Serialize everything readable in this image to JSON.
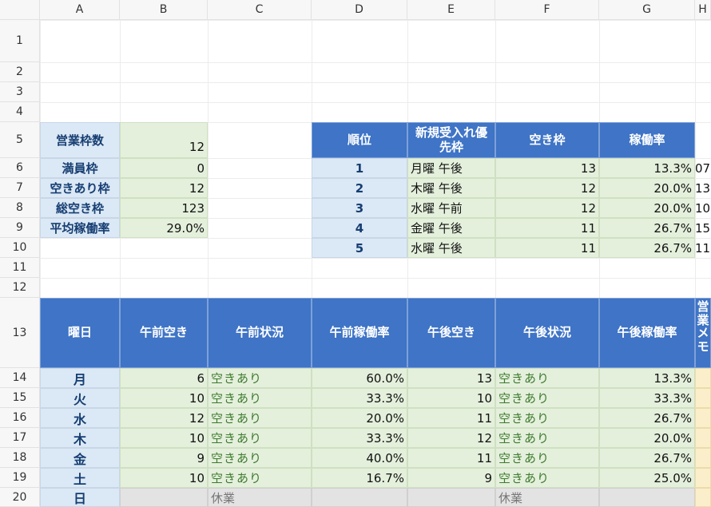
{
  "columns": [
    "A",
    "B",
    "C",
    "D",
    "E",
    "F",
    "G",
    "H"
  ],
  "rows": [
    "1",
    "2",
    "3",
    "4",
    "5",
    "6",
    "7",
    "8",
    "9",
    "10",
    "11",
    "12",
    "13",
    "14",
    "15",
    "16",
    "17",
    "18",
    "19",
    "20"
  ],
  "summary": [
    {
      "label": "営業枠数",
      "value": "12"
    },
    {
      "label": "満員枠",
      "value": "0"
    },
    {
      "label": "空きあり枠",
      "value": "12"
    },
    {
      "label": "総空き枠",
      "value": "123"
    },
    {
      "label": "平均稼働率",
      "value": "29.0%"
    }
  ],
  "ranking": {
    "headers": [
      "順位",
      "新規受入れ優先枠",
      "空き枠",
      "稼働率"
    ],
    "rows": [
      {
        "rank": "1",
        "slot": "月曜 午後",
        "free": "13",
        "rate": "13.3%",
        "extra": "07"
      },
      {
        "rank": "2",
        "slot": "木曜 午後",
        "free": "12",
        "rate": "20.0%",
        "extra": "13"
      },
      {
        "rank": "3",
        "slot": "水曜 午前",
        "free": "12",
        "rate": "20.0%",
        "extra": "10"
      },
      {
        "rank": "4",
        "slot": "金曜 午後",
        "free": "11",
        "rate": "26.7%",
        "extra": "15"
      },
      {
        "rank": "5",
        "slot": "水曜 午後",
        "free": "11",
        "rate": "26.7%",
        "extra": "11"
      }
    ]
  },
  "schedule": {
    "headers": [
      "曜日",
      "午前空き",
      "午前状況",
      "午前稼働率",
      "午後空き",
      "午後状況",
      "午後稼働率",
      "営業メモ"
    ],
    "rows": [
      {
        "day": "月",
        "am_free": "6",
        "am_status": "空きあり",
        "am_rate": "60.0%",
        "pm_free": "13",
        "pm_status": "空きあり",
        "pm_rate": "13.3%"
      },
      {
        "day": "火",
        "am_free": "10",
        "am_status": "空きあり",
        "am_rate": "33.3%",
        "pm_free": "10",
        "pm_status": "空きあり",
        "pm_rate": "33.3%"
      },
      {
        "day": "水",
        "am_free": "12",
        "am_status": "空きあり",
        "am_rate": "20.0%",
        "pm_free": "11",
        "pm_status": "空きあり",
        "pm_rate": "26.7%"
      },
      {
        "day": "木",
        "am_free": "10",
        "am_status": "空きあり",
        "am_rate": "33.3%",
        "pm_free": "12",
        "pm_status": "空きあり",
        "pm_rate": "20.0%"
      },
      {
        "day": "金",
        "am_free": "9",
        "am_status": "空きあり",
        "am_rate": "40.0%",
        "pm_free": "11",
        "pm_status": "空きあり",
        "pm_rate": "26.7%"
      },
      {
        "day": "土",
        "am_free": "10",
        "am_status": "空きあり",
        "am_rate": "16.7%",
        "pm_free": "9",
        "pm_status": "空きあり",
        "pm_rate": "25.0%"
      },
      {
        "day": "日",
        "am_free": "",
        "am_status": "休業",
        "am_rate": "",
        "pm_free": "",
        "pm_status": "休業",
        "pm_rate": ""
      }
    ]
  },
  "colors": {
    "header_blue": "#3f74c6",
    "label_blue": "#dbe8f5",
    "value_green": "#e4f0dc",
    "status_text_green": "#3f7a2f",
    "closed_grey": "#e3e3e3",
    "memo_yellow": "#fbeecb"
  }
}
